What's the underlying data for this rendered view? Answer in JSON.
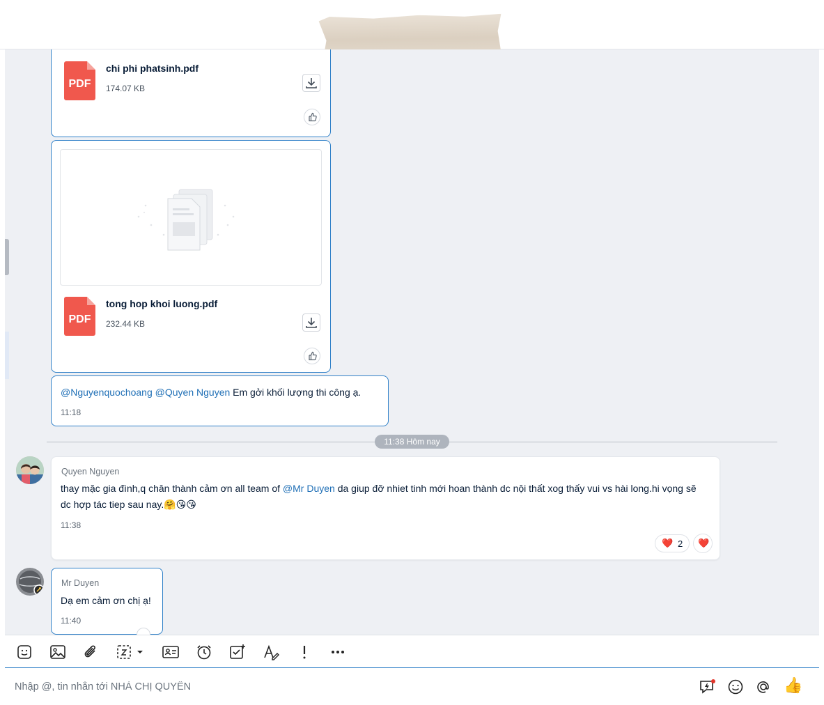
{
  "messages": {
    "file1": {
      "name": "chi phi phatsinh.pdf",
      "size": "174.07 KB",
      "type_label": "PDF"
    },
    "file2": {
      "name": "tong hop khoi luong.pdf",
      "size": "232.44 KB",
      "type_label": "PDF"
    },
    "mention_msg": {
      "mention1": "@Nguyenquochoang",
      "mention2": "@Quyen Nguyen",
      "text": " Em gởi khối lượng thi công ạ.",
      "time": "11:18"
    },
    "divider": "11:38 Hôm nay",
    "quyen_msg": {
      "sender": "Quyen Nguyen",
      "text_before": "thay mặc gia đình,q chân thành cảm ơn all team of ",
      "mention": "@Mr Duyen",
      "text_after": " da giup đỡ nhiet tinh mới hoan thành dc nội thất xog thấy vui vs hài long.hi vọng sẽ dc hợp tác tiep sau nay.",
      "emojis": "🤗😘😘",
      "time": "11:38",
      "reaction_count": "2",
      "reaction_emoji": "❤️",
      "react_button_emoji": "❤️"
    },
    "duyen_msg": {
      "sender": "Mr Duyen",
      "text": "Dạ em cảm ơn chị ạ!",
      "time": "11:40"
    }
  },
  "composer": {
    "placeholder": "Nhập @, tin nhắn tới NHÀ CHỊ QUYÊN",
    "thumb_emoji": "👍"
  },
  "toolbar_icons": [
    "sticker-icon",
    "image-icon",
    "attach-icon",
    "screenshot-icon",
    "contact-card-icon",
    "reminder-icon",
    "task-icon",
    "text-format-icon",
    "urgent-icon",
    "more-icon"
  ],
  "colors": {
    "accent": "#2f80c8",
    "mention": "#1f6fb6",
    "pdf": "#f0584d",
    "chat_bg": "#eef0f4"
  }
}
